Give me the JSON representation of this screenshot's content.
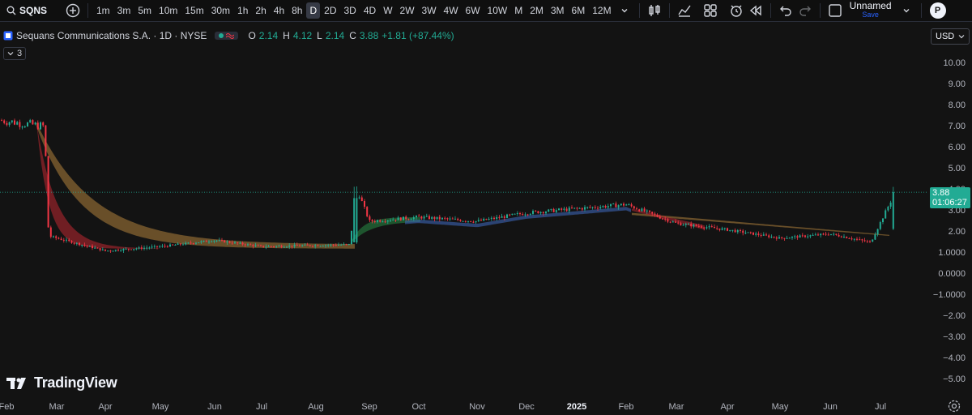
{
  "toolbar": {
    "symbol": "SQNS",
    "intervals": [
      "1m",
      "3m",
      "5m",
      "10m",
      "15m",
      "30m",
      "1h",
      "2h",
      "4h",
      "8h",
      "D",
      "2D",
      "3D",
      "4D",
      "W",
      "2W",
      "3W",
      "4W",
      "6W",
      "10W",
      "M",
      "2M",
      "3M",
      "6M",
      "12M"
    ],
    "active_interval": "D",
    "layout_name": "Unnamed",
    "save_label": "Save",
    "avatar_letter": "P"
  },
  "legend": {
    "title": "Sequans Communications S.A. · 1D · NYSE",
    "ohlc": [
      {
        "label": "O",
        "value": "2.14"
      },
      {
        "label": "H",
        "value": "4.12"
      },
      {
        "label": "L",
        "value": "2.14"
      },
      {
        "label": "C",
        "value": "3.88"
      }
    ],
    "change": "+1.81 (+87.44%)",
    "indicator_count": "3"
  },
  "currency": "USD",
  "price_axis": {
    "ticks": [
      "10.00",
      "9.00",
      "8.00",
      "7.00",
      "6.00",
      "5.00",
      "4.00",
      "3.00",
      "2.00",
      "1.0000",
      "0.0000",
      "−1.0000",
      "−2.00",
      "−3.00",
      "−4.00",
      "−5.00"
    ],
    "last_price": "3.88",
    "countdown": "01:06:27"
  },
  "date_axis": [
    "Feb",
    "Mar",
    "Apr",
    "May",
    "Jun",
    "Jul",
    "Aug",
    "Sep",
    "Oct",
    "Nov",
    "Dec",
    "2025",
    "Feb",
    "Mar",
    "Apr",
    "May",
    "Jun",
    "Jul"
  ],
  "brand": "TradingView",
  "colors": {
    "up": "#22ab94",
    "down": "#f23645",
    "background": "#131313",
    "accent": "#2962ff"
  },
  "chart_data": {
    "type": "line",
    "title": "",
    "xlabel": "",
    "ylabel": "",
    "ylim": [
      -5,
      10
    ],
    "x": [
      "2024-02",
      "2024-03-05",
      "2024-03-20",
      "2024-04-05",
      "2024-05",
      "2024-06",
      "2024-07",
      "2024-08-20",
      "2024-08-22",
      "2024-09",
      "2024-10",
      "2024-11",
      "2024-12",
      "2025-01",
      "2025-02",
      "2025-03",
      "2025-04",
      "2025-05",
      "2025-06",
      "2025-06-28",
      "2025-07-08"
    ],
    "series": [
      {
        "values": [
          7.3,
          7.0,
          1.8,
          1.1,
          1.3,
          1.6,
          1.3,
          1.4,
          4.1,
          2.5,
          2.7,
          2.5,
          2.9,
          3.1,
          3.3,
          2.4,
          2.1,
          1.7,
          1.9,
          1.5,
          3.88
        ]
      }
    ]
  }
}
